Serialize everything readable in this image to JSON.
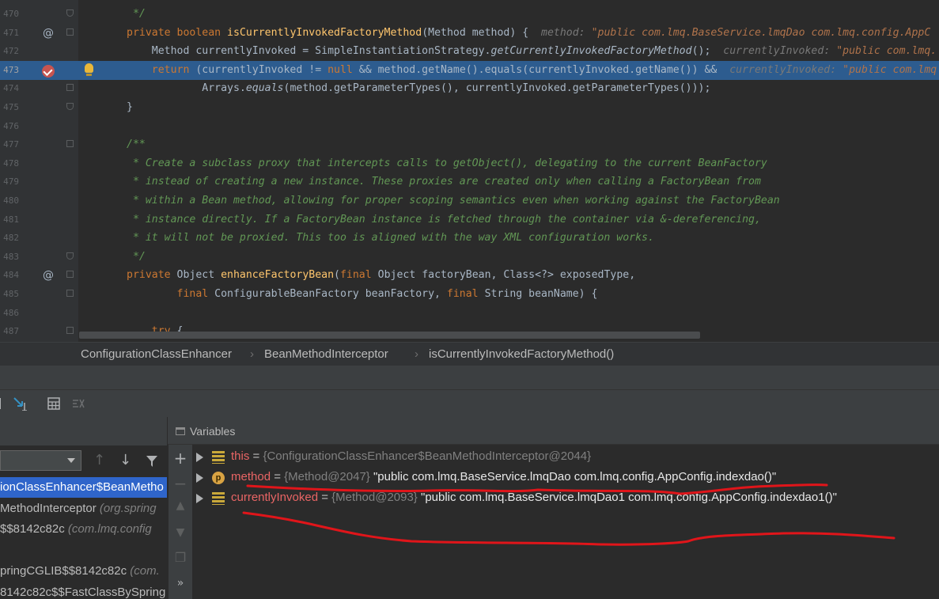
{
  "editor": {
    "lines": [
      {
        "num": "470",
        "parts": [
          {
            "t": " */",
            "c": "cmt"
          }
        ]
      },
      {
        "num": "471",
        "parts": [
          {
            "t": "private boolean ",
            "c": "kw"
          },
          {
            "t": "isCurrentlyInvokedFactoryMethod",
            "c": "fn"
          },
          {
            "t": "(Method method) {  ",
            "c": ""
          },
          {
            "t": "method: ",
            "c": "hint"
          },
          {
            "t": "\"public com.lmq.BaseService.lmqDao com.lmq.config.AppC",
            "c": "hintstr"
          }
        ]
      },
      {
        "num": "472",
        "parts": [
          {
            "t": "    Method currentlyInvoked = SimpleInstantiationStrategy.",
            "c": ""
          },
          {
            "t": "getCurrentlyInvokedFactoryMethod",
            "c": "it"
          },
          {
            "t": "();  ",
            "c": ""
          },
          {
            "t": "currentlyInvoked: ",
            "c": "hint"
          },
          {
            "t": "\"public com.lmq.",
            "c": "hintstr"
          }
        ]
      },
      {
        "num": "473",
        "parts": [
          {
            "t": "    return ",
            "c": "kw"
          },
          {
            "t": "(currentlyInvoked != ",
            "c": ""
          },
          {
            "t": "null",
            "c": "nul"
          },
          {
            "t": " && method.getName().equals(currentlyInvoked.getName()) &&  ",
            "c": ""
          },
          {
            "t": "currentlyInvoked: ",
            "c": "hint"
          },
          {
            "t": "\"public com.lmq",
            "c": "hintstr"
          }
        ]
      },
      {
        "num": "474",
        "parts": [
          {
            "t": "            Arrays.",
            "c": ""
          },
          {
            "t": "equals",
            "c": "it"
          },
          {
            "t": "(method.getParameterTypes(), currentlyInvoked.getParameterTypes()));",
            "c": ""
          }
        ]
      },
      {
        "num": "475",
        "parts": [
          {
            "t": "}",
            "c": ""
          }
        ]
      },
      {
        "num": "476",
        "parts": []
      },
      {
        "num": "477",
        "parts": [
          {
            "t": "/**",
            "c": "cmt"
          }
        ]
      },
      {
        "num": "478",
        "parts": [
          {
            "t": " * Create a subclass proxy that intercepts calls to getObject(), delegating to the current BeanFactory",
            "c": "cmt"
          }
        ]
      },
      {
        "num": "479",
        "parts": [
          {
            "t": " * instead of creating a new instance. These proxies are created only when calling a FactoryBean from",
            "c": "cmt"
          }
        ]
      },
      {
        "num": "480",
        "parts": [
          {
            "t": " * within a Bean method, allowing for proper scoping semantics even when working against the FactoryBean",
            "c": "cmt"
          }
        ]
      },
      {
        "num": "481",
        "parts": [
          {
            "t": " * instance directly. If a FactoryBean instance is fetched through the container via &-dereferencing,",
            "c": "cmt"
          }
        ]
      },
      {
        "num": "482",
        "parts": [
          {
            "t": " * it will not be proxied. This too is aligned with the way XML configuration works.",
            "c": "cmt"
          }
        ]
      },
      {
        "num": "483",
        "parts": [
          {
            "t": " */",
            "c": "cmt"
          }
        ]
      },
      {
        "num": "484",
        "parts": [
          {
            "t": "private ",
            "c": "kw"
          },
          {
            "t": "Object ",
            "c": ""
          },
          {
            "t": "enhanceFactoryBean",
            "c": "fn"
          },
          {
            "t": "(",
            "c": ""
          },
          {
            "t": "final ",
            "c": "kw"
          },
          {
            "t": "Object factoryBean, Class<?> exposedType,",
            "c": ""
          }
        ]
      },
      {
        "num": "485",
        "parts": [
          {
            "t": "        final ",
            "c": "kw"
          },
          {
            "t": "ConfigurableBeanFactory beanFactory, ",
            "c": ""
          },
          {
            "t": "final ",
            "c": "kw"
          },
          {
            "t": "String beanName) {",
            "c": ""
          }
        ]
      },
      {
        "num": "486",
        "parts": []
      },
      {
        "num": "487",
        "parts": [
          {
            "t": "    try ",
            "c": "kw"
          },
          {
            "t": "{",
            "c": ""
          }
        ]
      }
    ]
  },
  "breadcrumb": {
    "items": [
      "ConfigurationClassEnhancer",
      "BeanMethodInterceptor",
      "isCurrentlyInvokedFactoryMethod()"
    ],
    "separator": "›"
  },
  "frames": {
    "items": [
      {
        "label": "ionClassEnhancer$BeanMetho",
        "pkg": ""
      },
      {
        "label": "MethodInterceptor ",
        "pkg": "(org.spring"
      },
      {
        "label": "$$8142c82c ",
        "pkg": "(com.lmq.config"
      },
      {
        "label": "",
        "pkg": ""
      },
      {
        "label": "pringCGLIB$$8142c82c ",
        "pkg": "(com."
      },
      {
        "label": "8142c82c$$FastClassBySpring",
        "pkg": ""
      }
    ]
  },
  "variables": {
    "title": "Variables",
    "items": [
      {
        "name": "this",
        "eq": " = ",
        "type": "{ConfigurationClassEnhancer$BeanMethodInterceptor@2044}",
        "value": "",
        "icon": "field-icon"
      },
      {
        "name": "method",
        "eq": " = ",
        "type": "{Method@2047} ",
        "value": "\"public com.lmq.BaseService.lmqDao com.lmq.config.AppConfig.indexdao()\"",
        "icon": "parameter-icon",
        "icon_letter": "p"
      },
      {
        "name": "currentlyInvoked",
        "eq": " = ",
        "type": "{Method@2093} ",
        "value": "\"public com.lmq.BaseService.lmqDao1 com.lmq.config.AppConfig.indexdao1()\"",
        "icon": "field-icon"
      }
    ]
  },
  "side_buttons": {
    "more": "»"
  },
  "colors": {
    "highlight_line": "#2d5c8f",
    "selected_frame": "#2f65ca",
    "annotation_red": "#e0151a",
    "keyword": "#cc7832",
    "method_decl": "#ffc66d",
    "comment": "#629755"
  }
}
